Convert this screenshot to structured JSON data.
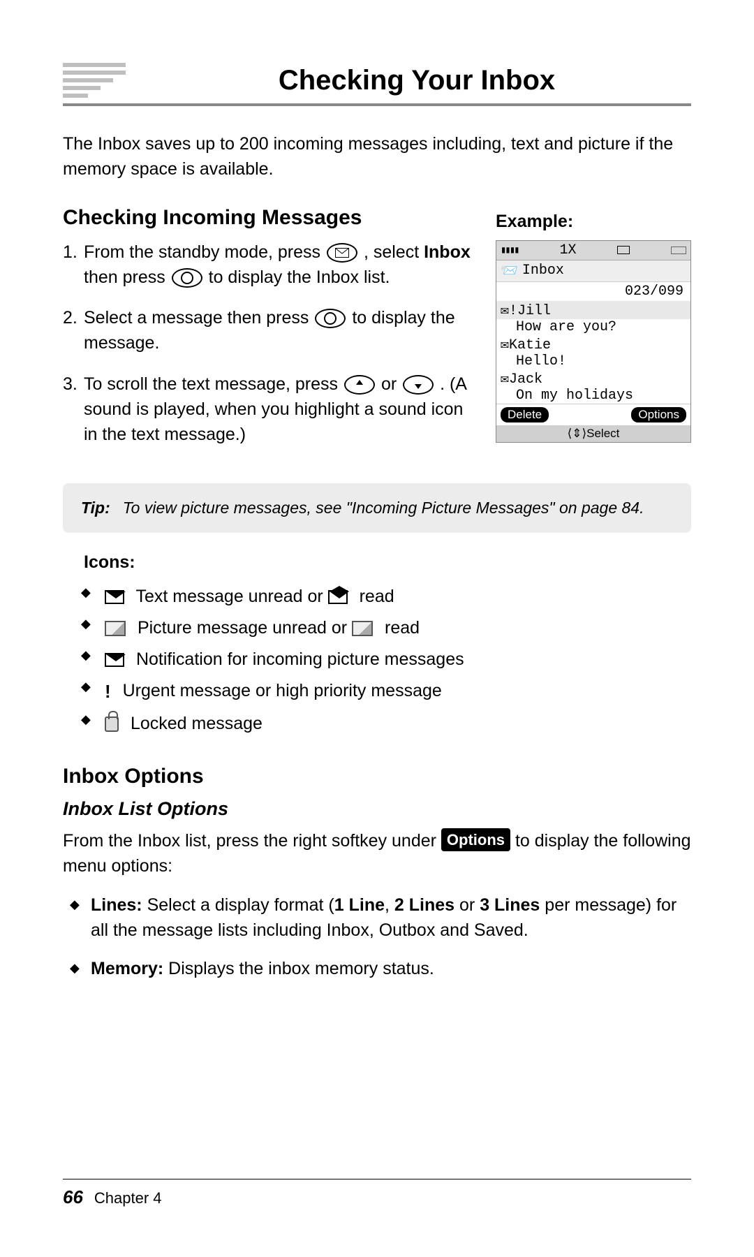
{
  "title": "Checking Your Inbox",
  "intro": "The Inbox saves up to 200 incoming messages including, text and picture if the memory space is available.",
  "section1": {
    "heading": "Checking Incoming Messages",
    "steps": {
      "s1a": "From the standby mode, press ",
      "s1b": ", se­lect ",
      "s1c": "Inbox",
      "s1d": " then press ",
      "s1e": " to display the Inbox list.",
      "s2a": "Select a message then press ",
      "s2b": " to dis­play the message.",
      "s3a": "To scroll the text message, press ",
      "s3b": " or ",
      "s3c": ". (A sound is played, when you high­light a sound icon in the text message.)"
    }
  },
  "example": {
    "label": "Example:",
    "status_net": "1X",
    "title_line": "Inbox",
    "count": "023/099",
    "items": [
      {
        "sender": "!Jill",
        "preview": "How are you?"
      },
      {
        "sender": "Katie",
        "preview": "Hello!"
      },
      {
        "sender": "Jack",
        "preview": "On my holidays"
      }
    ],
    "soft_left": "Delete",
    "soft_right": "Options",
    "nav": "Select"
  },
  "tip": {
    "label": "Tip:",
    "text": "To view picture messages, see \"Incoming Picture Messages\" on page 84."
  },
  "icons": {
    "heading": "Icons:",
    "i1a": "Text message unread or ",
    "i1b": " read",
    "i2a": "Picture message unread or ",
    "i2b": " read",
    "i3": "Notification for incoming picture messages",
    "i4": "Urgent message or high priority message",
    "i5": "Locked message"
  },
  "section2": {
    "heading": "Inbox Options",
    "sub": "Inbox List Options",
    "p1a": "From the Inbox list, press the right softkey under ",
    "p1_opt": "Options",
    "p1b": " to display the following menu options:",
    "b1a": "Lines:",
    "b1b": " Select a display format (",
    "b1c": "1 Line",
    "b1d": ", ",
    "b1e": "2 Lines",
    "b1f": " or ",
    "b1g": "3 Lines",
    "b1h": " per mes­sage) for all the message lists including Inbox, Outbox and Saved.",
    "b2a": "Memory:",
    "b2b": " Displays the inbox memory status."
  },
  "footer": {
    "page": "66",
    "chapter": "Chapter 4"
  }
}
